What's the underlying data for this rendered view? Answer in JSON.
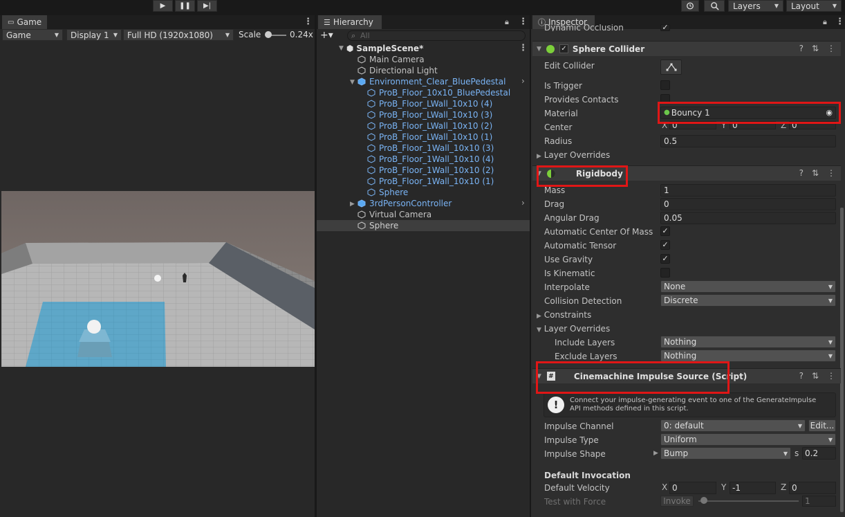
{
  "toolbar": {
    "play": "▶",
    "pause": "❚❚",
    "step": "▶|",
    "layers": "Layers",
    "layout": "Layout"
  },
  "game": {
    "tab": "Game",
    "mode": "Game",
    "display": "Display 1",
    "resolution": "Full HD (1920x1080)",
    "scale_label": "Scale",
    "scale_value": "0.24x"
  },
  "hierarchy": {
    "tab": "Hierarchy",
    "search_placeholder": "All",
    "scene": "SampleScene*",
    "items": [
      "Main Camera",
      "Directional Light",
      "Environment_Clear_BluePedestal",
      "ProB_Floor_10x10_BluePedestal",
      "ProB_Floor_LWall_10x10 (4)",
      "ProB_Floor_LWall_10x10 (3)",
      "ProB_Floor_LWall_10x10 (2)",
      "ProB_Floor_LWall_10x10 (1)",
      "ProB_Floor_1Wall_10x10 (3)",
      "ProB_Floor_1Wall_10x10 (4)",
      "ProB_Floor_1Wall_10x10 (2)",
      "ProB_Floor_1Wall_10x10 (1)",
      "Sphere",
      "3rdPersonController",
      "Virtual Camera",
      "Sphere"
    ]
  },
  "inspector": {
    "tab": "Inspector",
    "cut_label": "Dynamic Occlusion",
    "sphere_collider": {
      "title": "Sphere Collider",
      "edit_collider": "Edit Collider",
      "is_trigger": "Is Trigger",
      "provides_contacts": "Provides Contacts",
      "material": "Material",
      "material_value": "Bouncy 1",
      "center": "Center",
      "cx": "X",
      "cy": "Y",
      "cz": "Z",
      "cxv": "0",
      "cyv": "0",
      "czv": "0",
      "radius": "Radius",
      "radius_value": "0.5",
      "layer_overrides": "Layer Overrides"
    },
    "rigidbody": {
      "title": "Rigidbody",
      "mass": "Mass",
      "mass_value": "1",
      "drag": "Drag",
      "drag_value": "0",
      "angular_drag": "Angular Drag",
      "angular_drag_value": "0.05",
      "auto_com": "Automatic Center Of Mass",
      "auto_tensor": "Automatic Tensor",
      "use_gravity": "Use Gravity",
      "is_kinematic": "Is Kinematic",
      "interpolate": "Interpolate",
      "interpolate_value": "None",
      "collision": "Collision Detection",
      "collision_value": "Discrete",
      "constraints": "Constraints",
      "layer_overrides": "Layer Overrides",
      "include": "Include Layers",
      "include_value": "Nothing",
      "exclude": "Exclude Layers",
      "exclude_value": "Nothing"
    },
    "impulse": {
      "title": "Cinemachine Impulse Source (Script)",
      "help": "Connect your impulse-generating event to one of the GenerateImpulse API methods defined in this script.",
      "channel": "Impulse Channel",
      "channel_value": "0: default",
      "edit": "Edit...",
      "type": "Impulse Type",
      "type_value": "Uniform",
      "shape": "Impulse Shape",
      "shape_value": "Bump",
      "s_label": "s",
      "s_value": "0.2",
      "default_invocation": "Default Invocation",
      "default_velocity": "Default Velocity",
      "vx": "X",
      "vy": "Y",
      "vz": "Z",
      "vxv": "0",
      "vyv": "-1",
      "vzv": "0",
      "test_force": "Test with Force",
      "invoke": "Invoke",
      "force_value": "1"
    }
  }
}
